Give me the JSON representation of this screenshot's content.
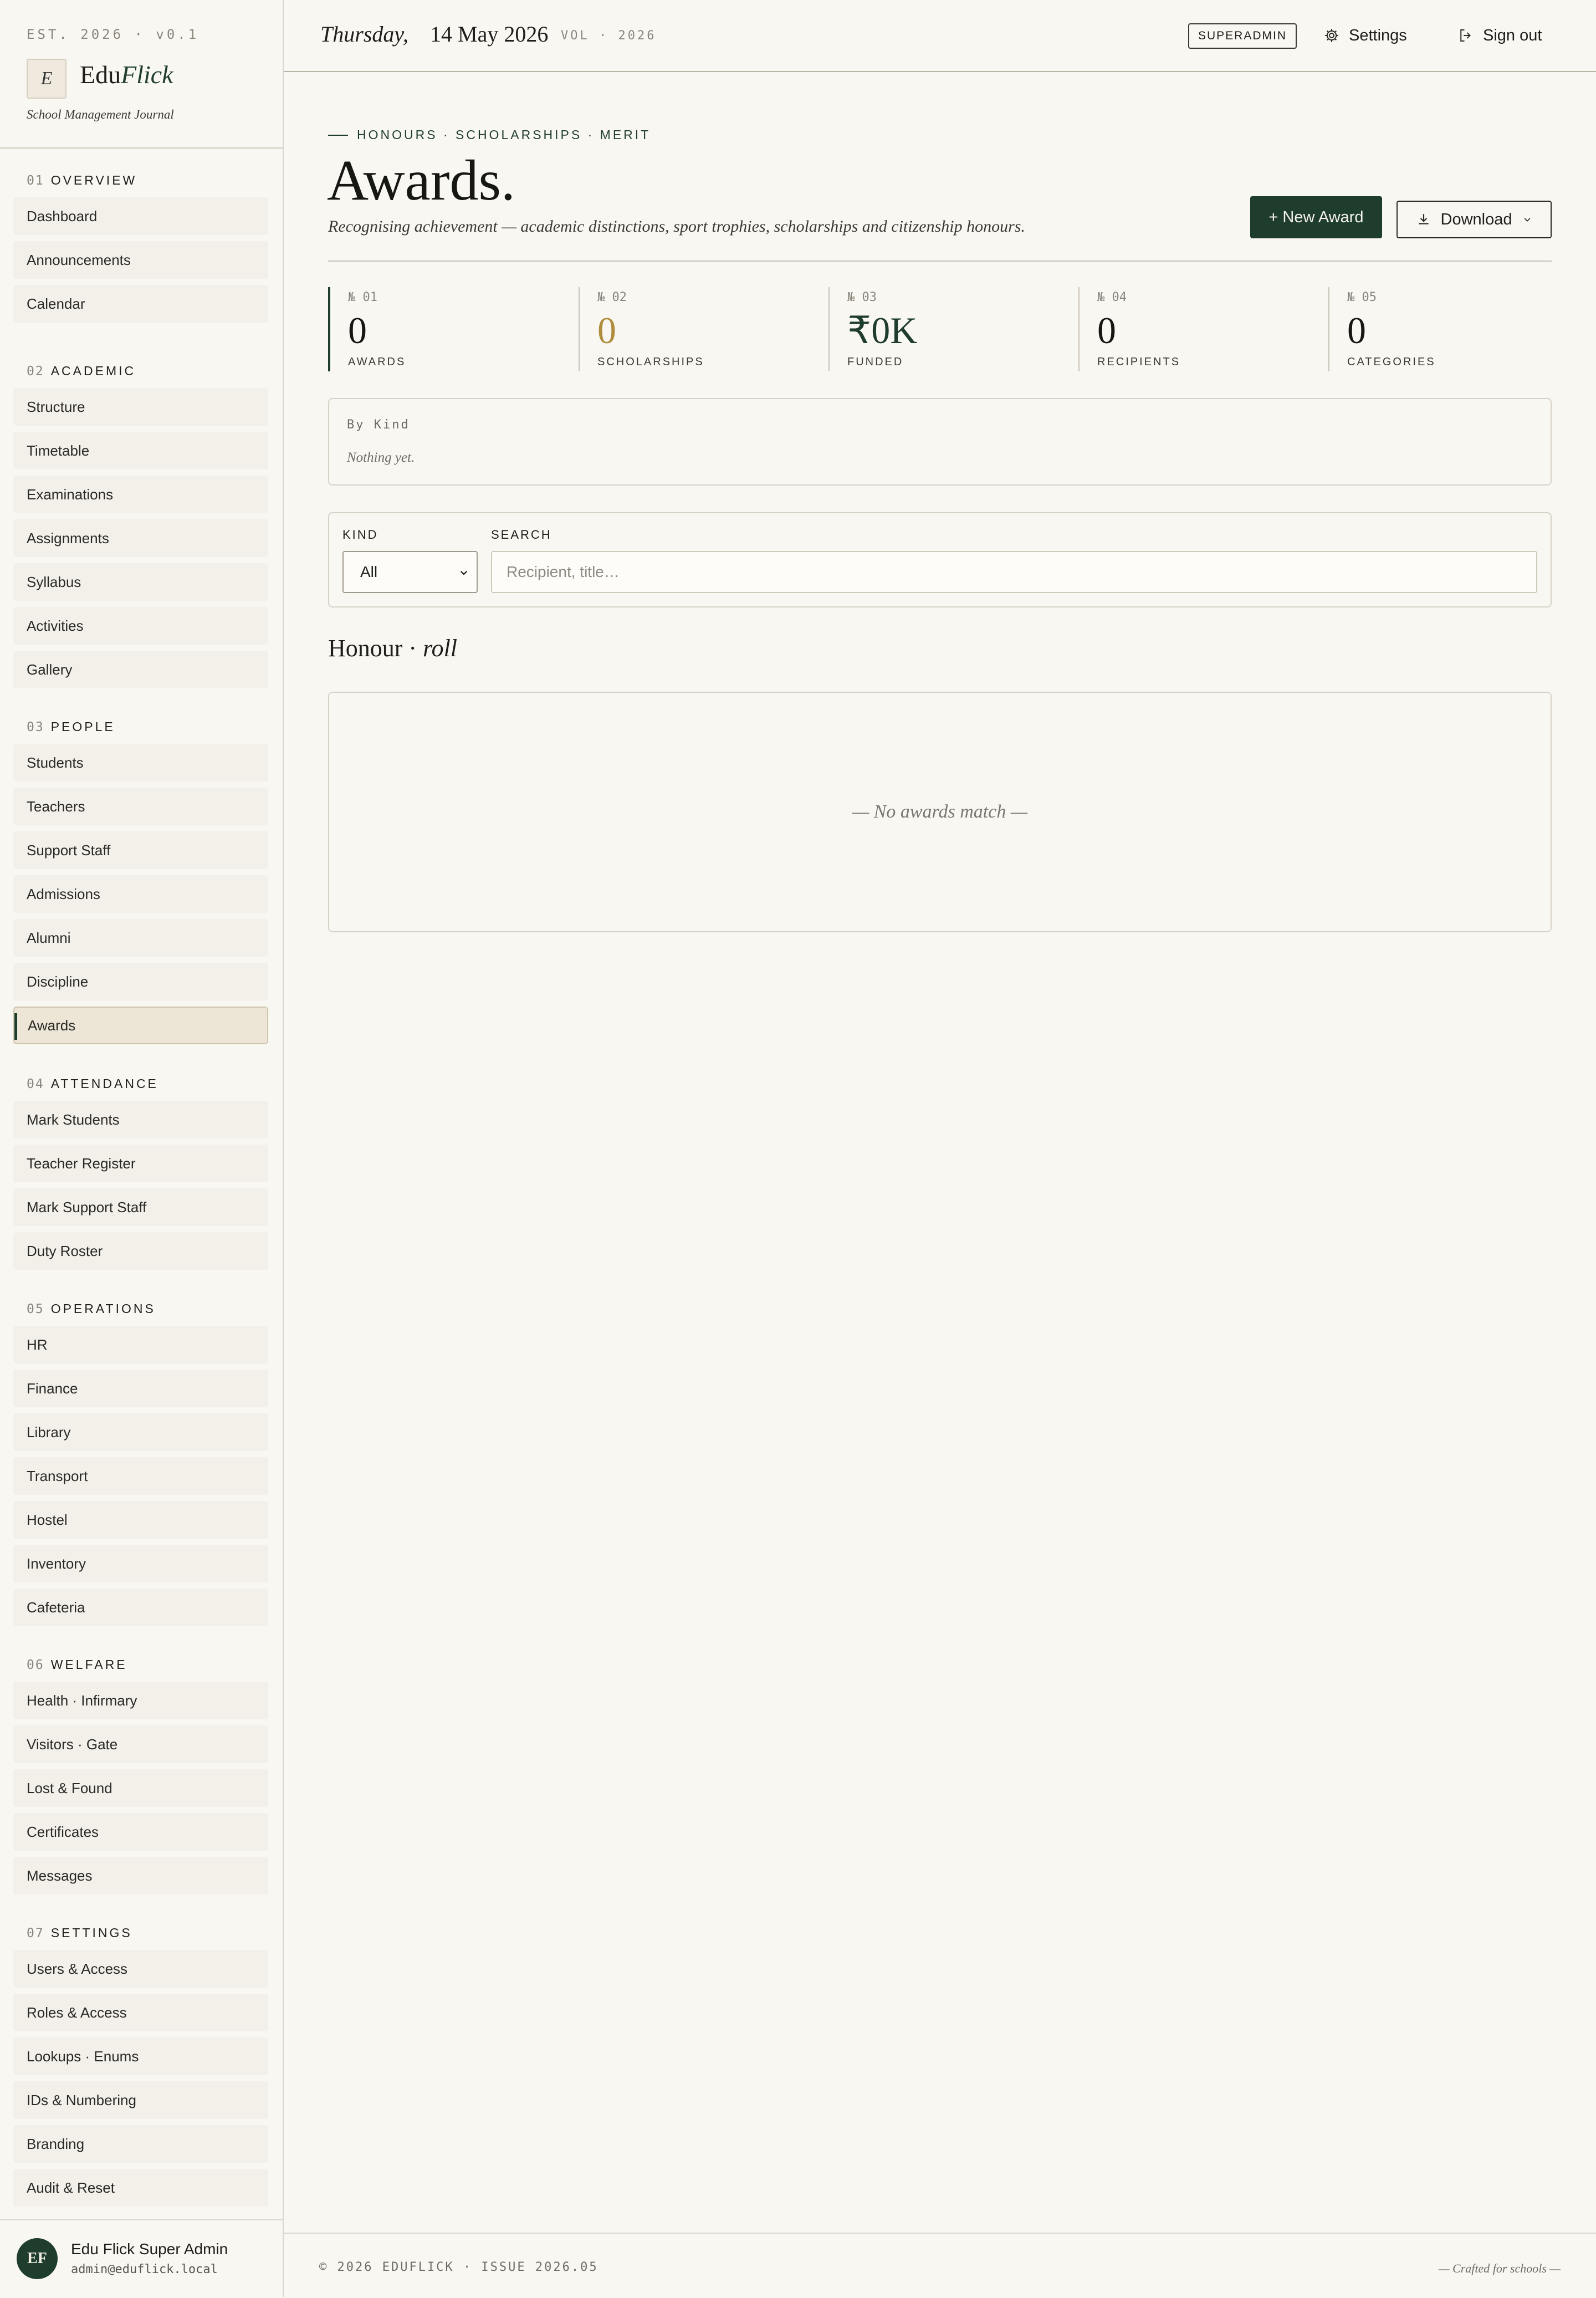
{
  "sidebar": {
    "est": "EST. 2026 · v0.1",
    "brand_mark": "E",
    "brand_name_a": "Edu",
    "brand_name_b": "Flick",
    "brand_tagline": "School Management Journal",
    "groups": [
      {
        "num": "01",
        "title": "OVERVIEW",
        "items": [
          "Dashboard",
          "Announcements",
          "Calendar"
        ]
      },
      {
        "num": "02",
        "title": "ACADEMIC",
        "items": [
          "Structure",
          "Timetable",
          "Examinations",
          "Assignments",
          "Syllabus",
          "Activities",
          "Gallery"
        ]
      },
      {
        "num": "03",
        "title": "PEOPLE",
        "items": [
          "Students",
          "Teachers",
          "Support Staff",
          "Admissions",
          "Alumni",
          "Discipline",
          "Awards"
        ]
      },
      {
        "num": "04",
        "title": "ATTENDANCE",
        "items": [
          "Mark Students",
          "Teacher Register",
          "Mark Support Staff",
          "Duty Roster"
        ]
      },
      {
        "num": "05",
        "title": "OPERATIONS",
        "items": [
          "HR",
          "Finance",
          "Library",
          "Transport",
          "Hostel",
          "Inventory",
          "Cafeteria"
        ]
      },
      {
        "num": "06",
        "title": "WELFARE",
        "items": [
          "Health · Infirmary",
          "Visitors · Gate",
          "Lost & Found",
          "Certificates",
          "Messages"
        ]
      },
      {
        "num": "07",
        "title": "SETTINGS",
        "items": [
          "Users & Access",
          "Roles & Access",
          "Lookups · Enums",
          "IDs & Numbering",
          "Branding",
          "Audit & Reset"
        ]
      }
    ],
    "active_item": "Awards",
    "user": {
      "initials": "EF",
      "name": "Edu Flick Super Admin",
      "email": "admin@eduflick.local"
    }
  },
  "topbar": {
    "day": "Thursday,",
    "date": "14 May 2026",
    "volume": "VOL · 2026",
    "role_badge": "SUPERADMIN",
    "settings_label": "Settings",
    "signout_label": "Sign out"
  },
  "page": {
    "eyebrow": "HONOURS · SCHOLARSHIPS · MERIT",
    "title": "Awards.",
    "subtitle": "Recognising achievement — academic distinctions, sport trophies, scholarships and citizenship honours.",
    "new_button": "+ New Award",
    "download_button": "Download"
  },
  "stats": [
    {
      "index": "№ 01",
      "value": "0",
      "label": "AWARDS",
      "color": "#161613"
    },
    {
      "index": "№ 02",
      "value": "0",
      "label": "SCHOLARSHIPS",
      "color": "#b08d3c"
    },
    {
      "index": "№ 03",
      "value": "₹0K",
      "label": "FUNDED",
      "color": "#1f3d2c"
    },
    {
      "index": "№ 04",
      "value": "0",
      "label": "RECIPIENTS",
      "color": "#161613"
    },
    {
      "index": "№ 05",
      "value": "0",
      "label": "CATEGORIES",
      "color": "#161613"
    }
  ],
  "by_kind": {
    "title": "By Kind",
    "empty": "Nothing yet."
  },
  "filters": {
    "kind_label": "KIND",
    "kind_value": "All",
    "search_label": "SEARCH",
    "search_placeholder": "Recipient, title…"
  },
  "honour_roll": {
    "title_a": "Honour · ",
    "title_b": "roll",
    "empty": "— No awards match —"
  },
  "footer": {
    "left": "© 2026 EDUFLICK · ISSUE 2026.05",
    "right": "— Crafted for schools —"
  }
}
